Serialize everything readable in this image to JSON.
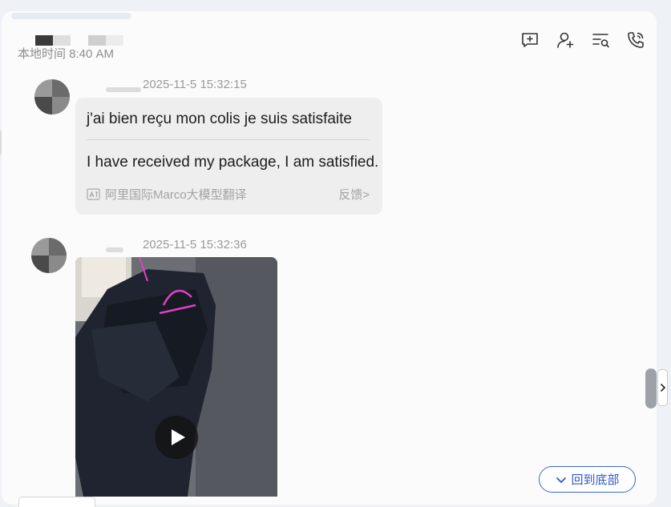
{
  "header": {
    "local_time": "本地时间 8:40 AM",
    "actions": [
      {
        "icon": "add-comment-icon"
      },
      {
        "icon": "add-user-icon"
      },
      {
        "icon": "search-list-icon"
      },
      {
        "icon": "phone-call-icon"
      }
    ]
  },
  "messages": [
    {
      "time": "2025-11-5 15:32:15",
      "original": "j'ai bien reçu mon colis je suis satisfaite",
      "translation": "I have received my package, I am satisfied.",
      "translation_credit": "阿里国际Marco大模型翻译",
      "feedback": "反馈>"
    },
    {
      "time": "2025-11-5 15:32:36",
      "type": "video"
    }
  ],
  "back_to_bottom": "回到底部",
  "colors": {
    "accent": "#3b66d6",
    "bubble": "#eeeeee",
    "text": "#1d1d1d",
    "muted": "#9a9a9a"
  }
}
